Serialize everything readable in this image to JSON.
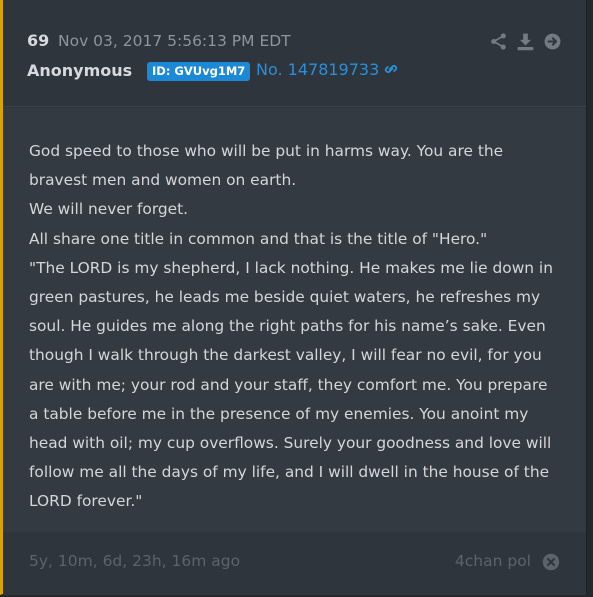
{
  "post": {
    "number": "69",
    "timestamp": "Nov 03, 2017 5:56:13 PM EDT",
    "author": "Anonymous",
    "id_badge": "ID: GVUvg1M7",
    "post_no": "No. 147819733"
  },
  "comment": {
    "lines": [
      "God speed to those who will be put in harms way. You are the bravest men and women on earth.",
      "We will never forget.",
      "All share one title in common and that is the title of \"Hero.\"",
      "\"The LORD is my shepherd, I lack nothing. He makes me lie down in green pastures, he leads me beside quiet waters, he refreshes my soul. He guides me along the right paths for his name’s sake. Even though I walk through the darkest valley, I will fear no evil, for you are with me; your rod and your staff, they comfort me. You prepare a table before me in the presence of my enemies. You anoint my head with oil; my cup overflows. Surely your goodness and love will follow me all the days of my life, and I will dwell in the house of the LORD forever.\""
    ]
  },
  "footer": {
    "age": "5y, 10m, 6d, 23h, 16m ago",
    "source": "4chan pol"
  },
  "icons": {
    "share": "share-icon",
    "download": "download-icon",
    "open": "arrow-right-circle-icon",
    "link": "link-icon",
    "close": "close-circle-icon"
  },
  "colors": {
    "accent_border": "#d9a400",
    "id_badge_bg": "#1c89d6",
    "post_no_link": "#2a8fd8"
  }
}
